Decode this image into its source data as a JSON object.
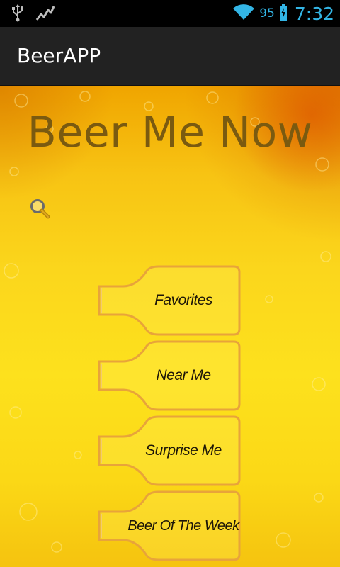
{
  "status_bar": {
    "icons": [
      "usb-icon",
      "activity-graph-icon",
      "wifi-icon",
      "battery-charging-icon"
    ],
    "battery_percent": "95",
    "time": "7:32",
    "accent_color": "#33b5e5"
  },
  "action_bar": {
    "title": "BeerAPP"
  },
  "main": {
    "heading": "Beer Me Now",
    "search_icon": "magnifier-icon",
    "buttons": [
      {
        "label": "Favorites"
      },
      {
        "label": "Near Me"
      },
      {
        "label": "Surprise Me"
      },
      {
        "label": "Beer Of The Week"
      }
    ]
  },
  "colors": {
    "heading_text": "#7a5a10",
    "bottle_outline": "#e8a43a",
    "background_yellow": "#fde11d"
  }
}
